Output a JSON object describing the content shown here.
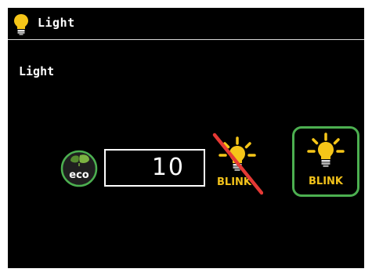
{
  "header": {
    "title": "Light",
    "icon": "lightbulb-icon"
  },
  "section": {
    "label": "Light"
  },
  "eco": {
    "label": "eco",
    "icon": "eco-leaf-icon"
  },
  "value": {
    "current": "10"
  },
  "blink_off": {
    "label": "BLINK",
    "icon": "lightbulb-blink-off-icon"
  },
  "blink_on": {
    "label": "BLINK",
    "icon": "lightbulb-blink-icon",
    "selected": true
  },
  "colors": {
    "background": "#000000",
    "text": "#ffffff",
    "bulb": "#f5c518",
    "accent_green": "#4caf50",
    "strike_red": "#e53935"
  }
}
